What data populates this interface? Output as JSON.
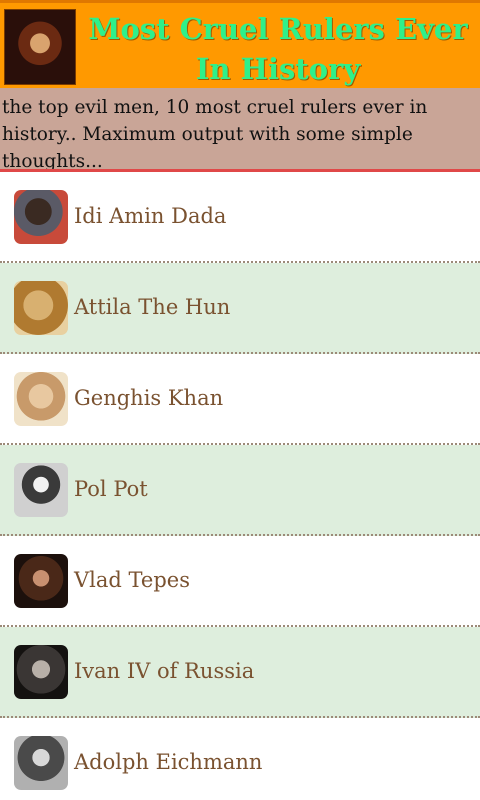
{
  "header": {
    "title": "Most Cruel Rulers Ever In History",
    "thumbnail_icon": "portrait-icon"
  },
  "description": "the top evil men, 10 most cruel rulers ever in history.. Maximum output with some simple thoughts...",
  "list": {
    "items": [
      {
        "label": "Idi Amin Dada",
        "thumbnail_icon": "portrait-icon"
      },
      {
        "label": "Attila The Hun",
        "thumbnail_icon": "portrait-icon"
      },
      {
        "label": "Genghis Khan",
        "thumbnail_icon": "portrait-icon"
      },
      {
        "label": "Pol Pot",
        "thumbnail_icon": "portrait-icon"
      },
      {
        "label": "Vlad Tepes",
        "thumbnail_icon": "portrait-icon"
      },
      {
        "label": "Ivan IV of Russia",
        "thumbnail_icon": "portrait-icon"
      },
      {
        "label": "Adolph Eichmann",
        "thumbnail_icon": "portrait-icon"
      }
    ]
  },
  "colors": {
    "header_bg": "#ff9900",
    "title_text": "#2ff08a",
    "description_bg": "#c9a597",
    "alt_row_bg": "#deeedd",
    "label_text": "#7a5230"
  }
}
